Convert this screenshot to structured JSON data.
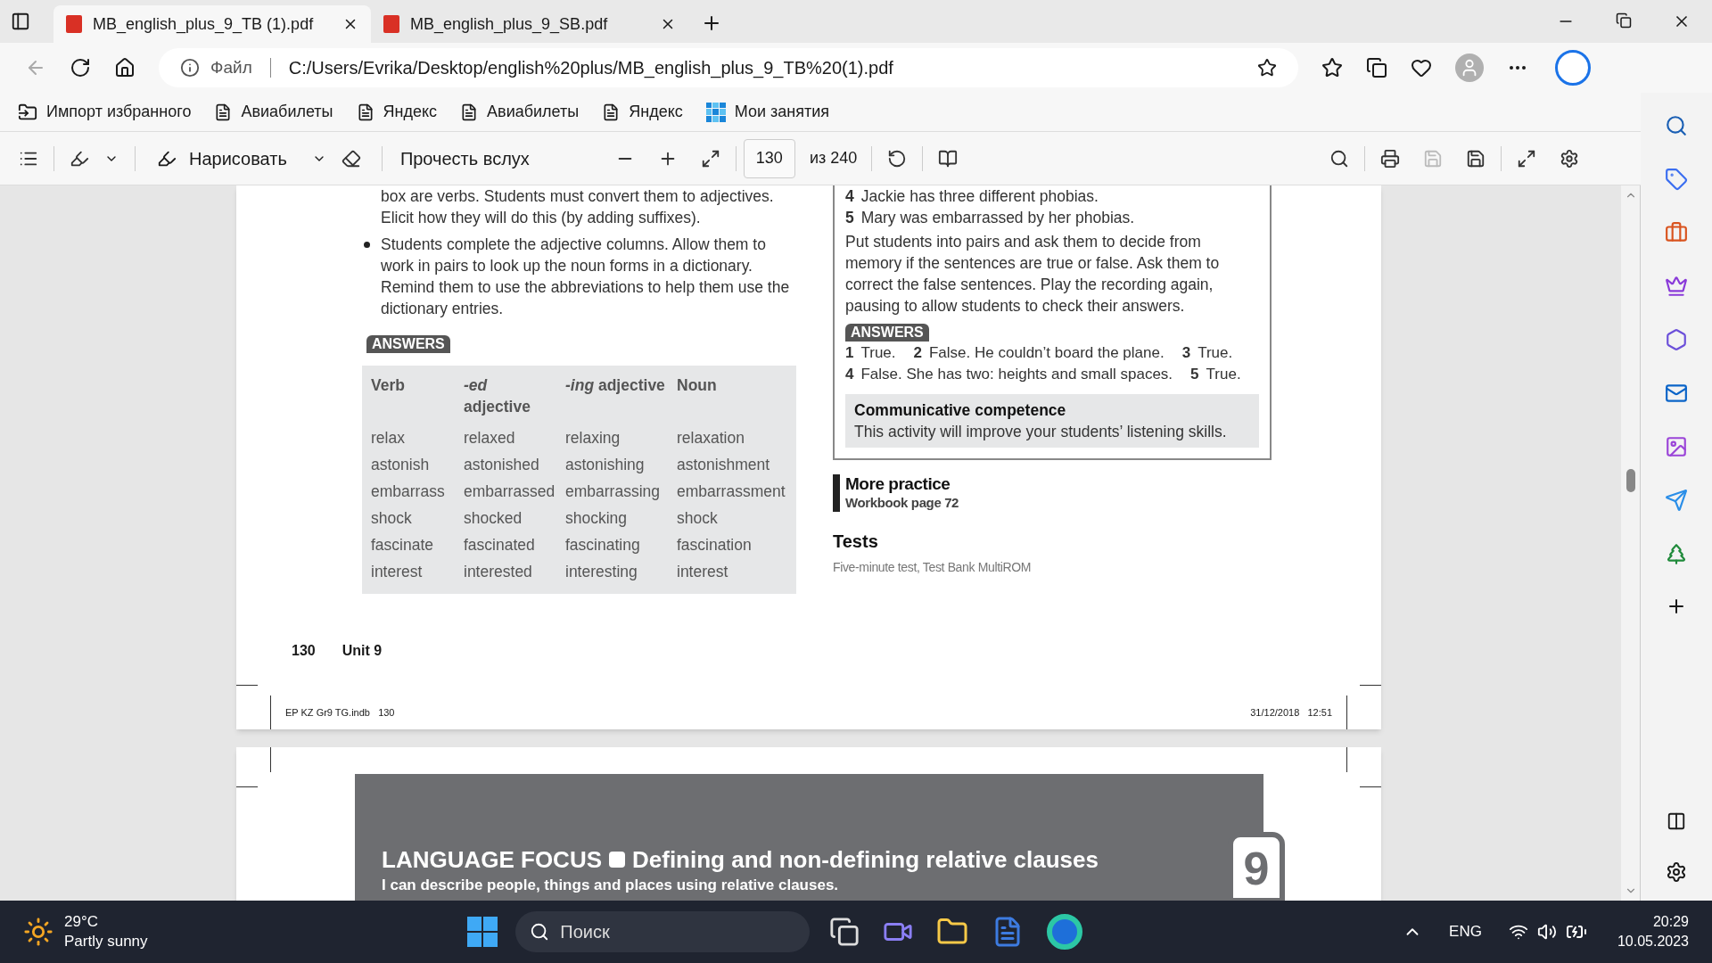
{
  "tabs": [
    {
      "title": "MB_english_plus_9_TB (1).pdf",
      "selected": true
    },
    {
      "title": "MB_english_plus_9_SB.pdf",
      "selected": false
    }
  ],
  "address": {
    "info_label": "Файл",
    "url": "C:/Users/Evrika/Desktop/english%20plus/MB_english_plus_9_TB%20(1).pdf"
  },
  "favorites": [
    {
      "label": "Импорт избранного",
      "kind": "import"
    },
    {
      "label": "Авиабилеты",
      "kind": "page"
    },
    {
      "label": "Яндекс",
      "kind": "page"
    },
    {
      "label": "Авиабилеты",
      "kind": "page"
    },
    {
      "label": "Яндекс",
      "kind": "page"
    },
    {
      "label": "Мои занятия",
      "kind": "app"
    }
  ],
  "pdf_toolbar": {
    "draw_label": "Нарисовать",
    "read_aloud_label": "Прочесть вслух",
    "page_number": "130",
    "page_total": "из 240"
  },
  "page1": {
    "left_paragraphs": [
      {
        "kind": "continuation",
        "text": "box are verbs. Students must convert them to adjectives. Elicit how they will do this (by adding suffixes)."
      },
      {
        "kind": "bullet",
        "text": "Students complete the adjective columns. Allow them to work in pairs to look up the noun forms in a dictionary. Remind them to use the abbreviations to help them use the dictionary entries."
      }
    ],
    "answers_label": "ANSWERS",
    "table": {
      "columns": [
        "Verb",
        "*-ed* adjective",
        "*-ing* adjective",
        "Noun"
      ],
      "rows": [
        [
          "relax",
          "relaxed",
          "relaxing",
          "relaxation"
        ],
        [
          "astonish",
          "astonished",
          "astonishing",
          "astonishment"
        ],
        [
          "embarrass",
          "embarrassed",
          "embarrassing",
          "embarrassment"
        ],
        [
          "shock",
          "shocked",
          "shocking",
          "shock"
        ],
        [
          "fascinate",
          "fascinated",
          "fascinating",
          "fascination"
        ],
        [
          "interest",
          "interested",
          "interesting",
          "interest"
        ]
      ]
    },
    "page_number": "130",
    "unit": "Unit 9",
    "box": {
      "statements": [
        {
          "num": "4",
          "text": "Jackie has three different phobias."
        },
        {
          "num": "5",
          "text": "Mary was embarrassed by her phobias."
        }
      ],
      "instructions": "Put students into pairs and ask them to decide from memory if the sentences are true or false. Ask them to correct the false sentences. Play the recording again, pausing to allow students to check their answers.",
      "answers_label": "ANSWERS",
      "answer_lines": [
        [
          {
            "num": "1",
            "text": "True."
          },
          {
            "num": "2",
            "text": "False. He couldn’t board the plane."
          },
          {
            "num": "3",
            "text": "True."
          }
        ],
        [
          {
            "num": "4",
            "text": "False. She has two: heights and small spaces."
          },
          {
            "num": "5",
            "text": "True."
          }
        ]
      ],
      "competence_title": "Communicative competence",
      "competence_text": "This activity will improve your students’ listening skills."
    },
    "more_practice": {
      "title": "More practice",
      "subtitle": "Workbook page 72"
    },
    "tests": {
      "title": "Tests",
      "text": "Five-minute test, Test Bank MultiROM"
    },
    "footer_left": "EP KZ Gr9 TG.indb   130",
    "footer_right": "31/12/2018   12:51"
  },
  "page2": {
    "title_kind": "LANGUAGE FOCUS",
    "title": "Defining and non-defining relative clauses",
    "subtitle": "I can describe people, things and places using relative clauses.",
    "unit_number": "9"
  },
  "taskbar": {
    "temperature": "29°C",
    "weather": "Partly sunny",
    "search_placeholder": "Поиск",
    "language": "ENG",
    "time": "20:29",
    "date": "10.05.2023"
  }
}
